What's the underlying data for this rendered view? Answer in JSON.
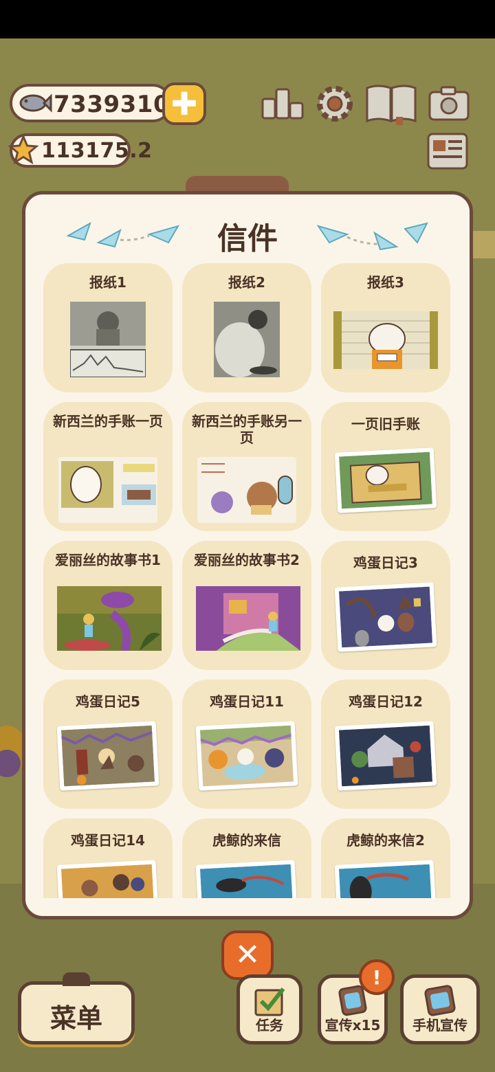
{
  "hud": {
    "fish_count": "7339310",
    "star_count": "113175.2",
    "icons": [
      "fish-icon",
      "plus-icon",
      "star-icon",
      "ranking-icon",
      "settings-gear-icon",
      "book-icon",
      "camera-icon",
      "newspaper-icon"
    ]
  },
  "modal": {
    "title": "信件",
    "letters": [
      {
        "label": "报纸1"
      },
      {
        "label": "报纸2"
      },
      {
        "label": "报纸3"
      },
      {
        "label": "新西兰的手账一页"
      },
      {
        "label": "新西兰的手账另一页"
      },
      {
        "label": "一页旧手账"
      },
      {
        "label": "爱丽丝的故事书1"
      },
      {
        "label": "爱丽丝的故事书2"
      },
      {
        "label": "鸡蛋日记3"
      },
      {
        "label": "鸡蛋日记5"
      },
      {
        "label": "鸡蛋日记11"
      },
      {
        "label": "鸡蛋日记12"
      },
      {
        "label": "鸡蛋日记14"
      },
      {
        "label": "虎鲸的来信"
      },
      {
        "label": "虎鲸的来信2"
      }
    ]
  },
  "bottom_bar": {
    "menu_label": "菜单",
    "tasks_label": "任务",
    "promo_label": "宣传x15",
    "phone_promo_label": "手机宣传",
    "alert_badge": "!"
  },
  "colors": {
    "border": "#6b4a3a",
    "card_bg": "#f4e6c2",
    "modal_bg": "#fbf5e9",
    "accent_orange": "#e86d2b",
    "accent_yellow": "#f5bf3a"
  }
}
